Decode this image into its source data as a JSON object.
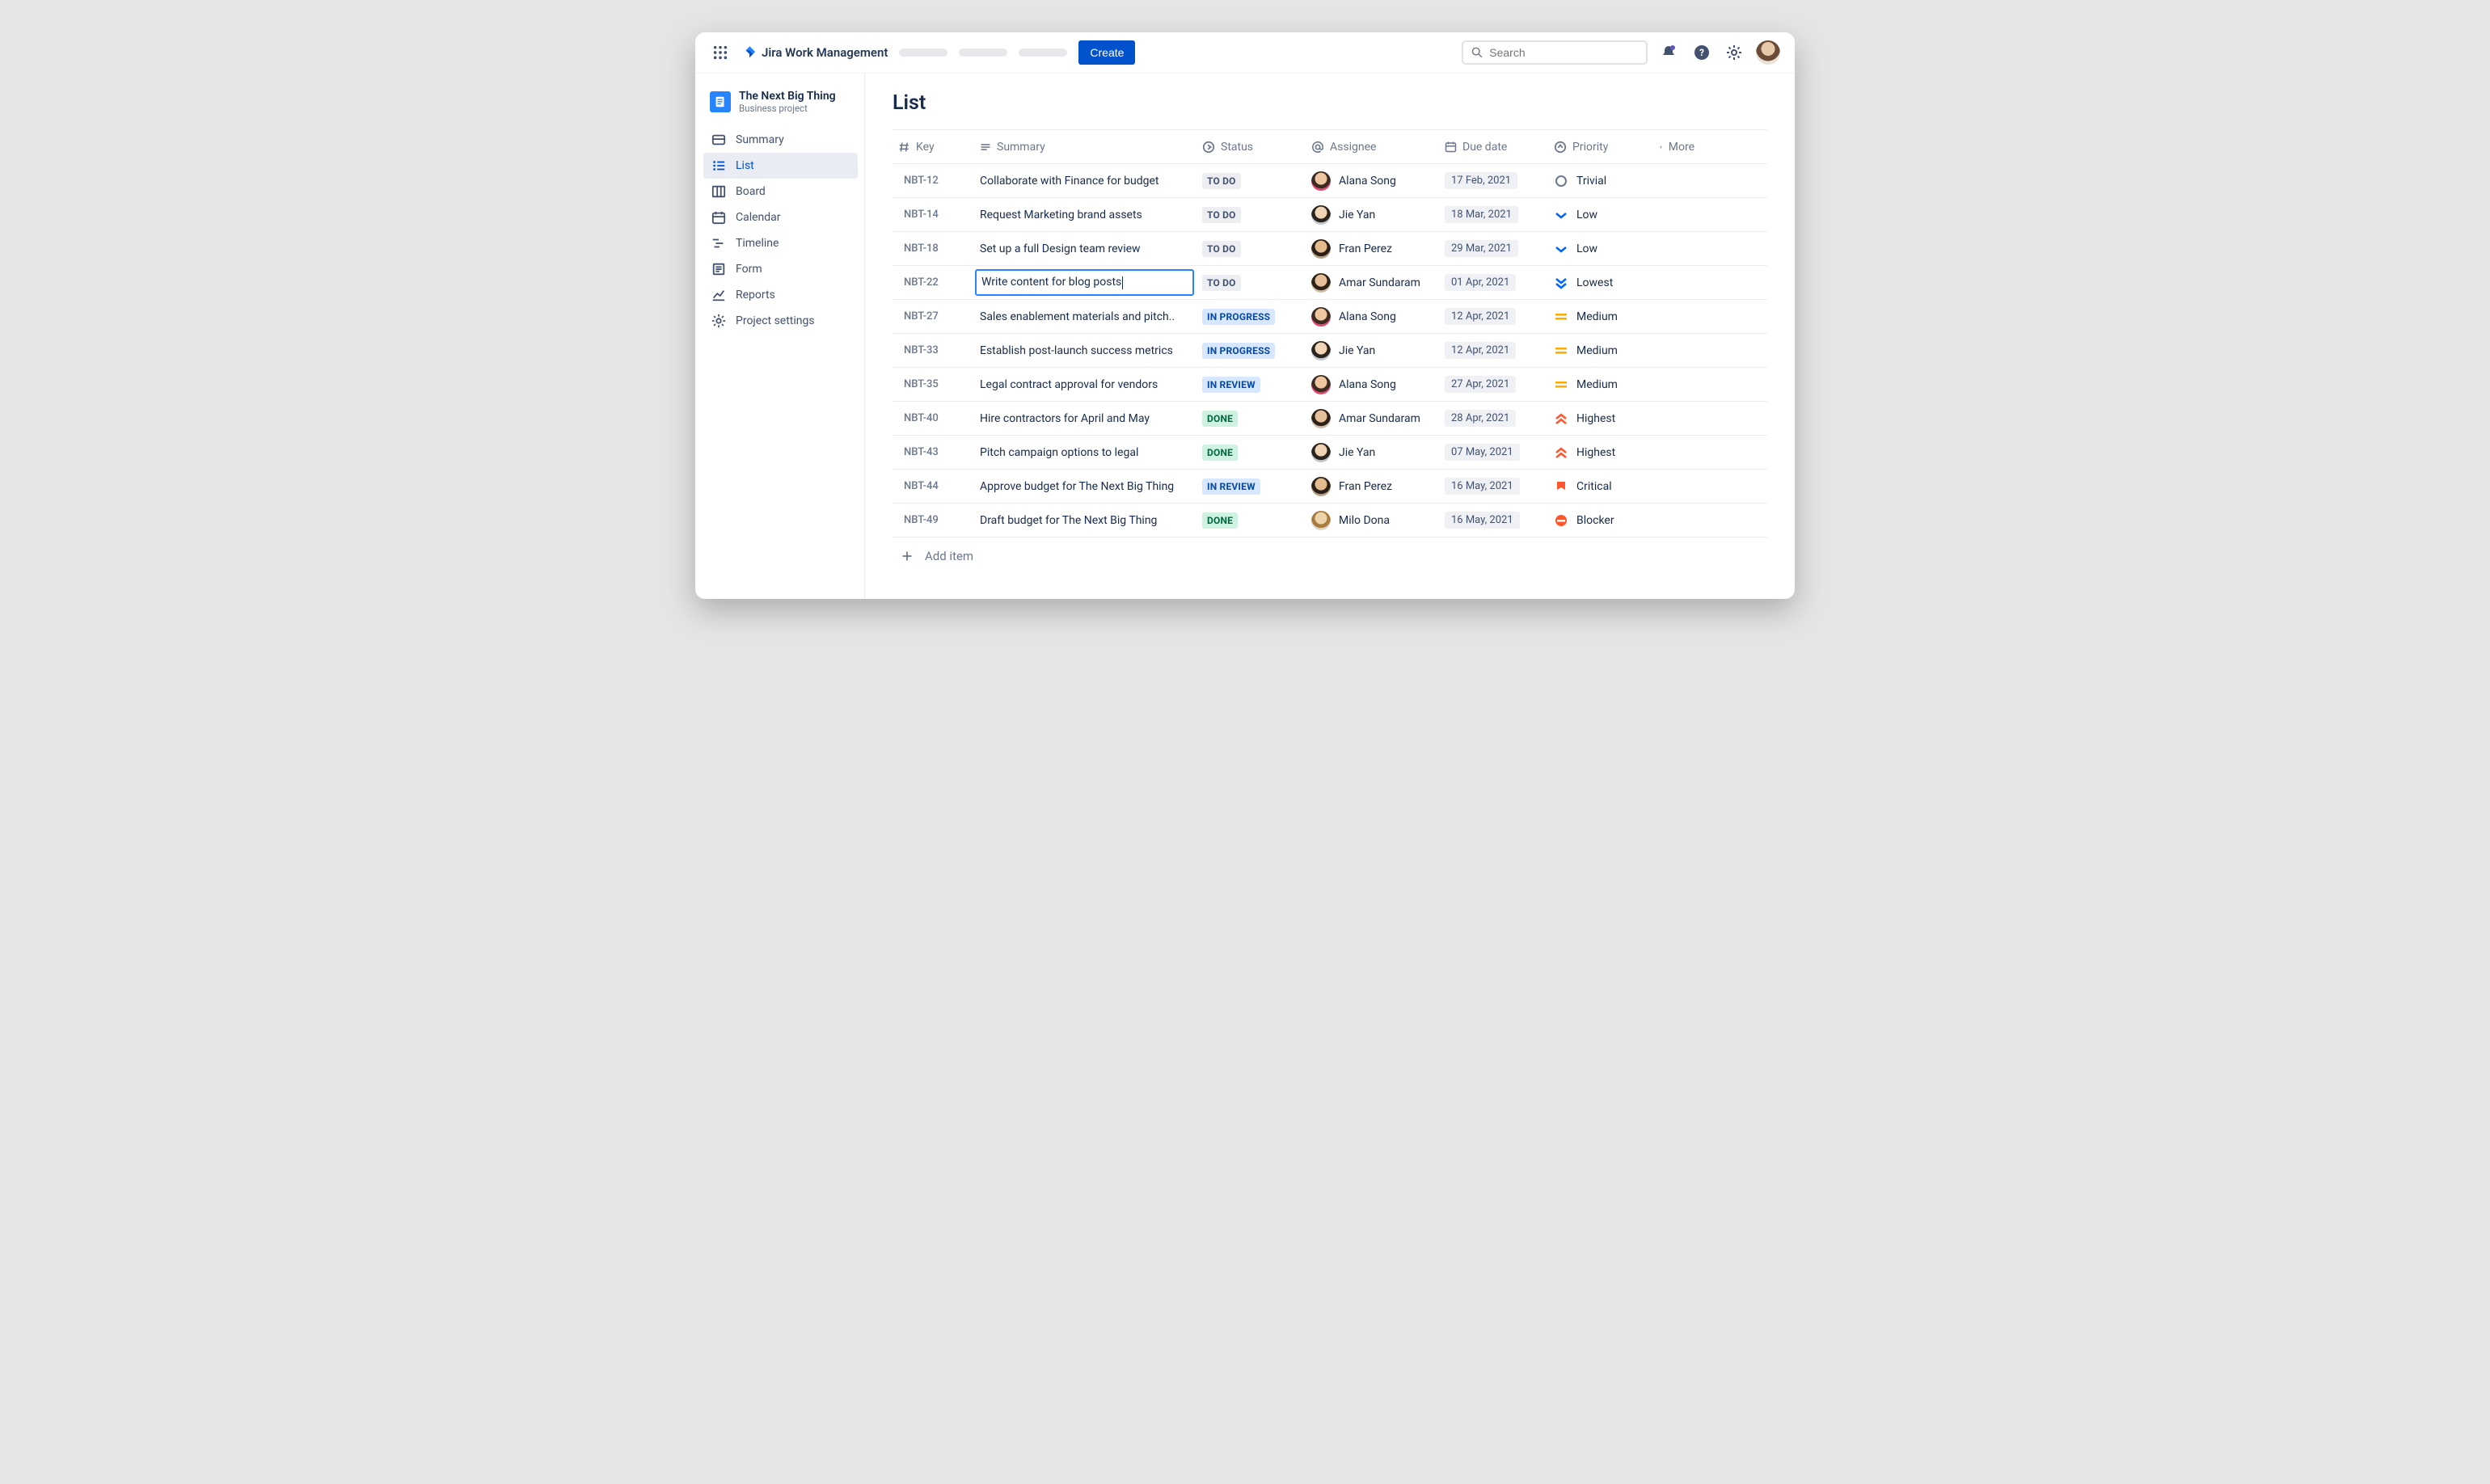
{
  "header": {
    "app_name": "Jira Work Management",
    "create_label": "Create",
    "search_placeholder": "Search"
  },
  "project": {
    "name": "The Next Big Thing",
    "subtitle": "Business project"
  },
  "sidebar": {
    "items": [
      {
        "label": "Summary",
        "icon": "card-icon"
      },
      {
        "label": "List",
        "icon": "list-icon",
        "active": true
      },
      {
        "label": "Board",
        "icon": "board-icon"
      },
      {
        "label": "Calendar",
        "icon": "calendar-icon"
      },
      {
        "label": "Timeline",
        "icon": "timeline-icon"
      },
      {
        "label": "Form",
        "icon": "form-icon"
      },
      {
        "label": "Reports",
        "icon": "chart-icon"
      },
      {
        "label": "Project settings",
        "icon": "gear-icon"
      }
    ]
  },
  "page": {
    "title": "List",
    "add_item_label": "Add item"
  },
  "columns": {
    "key": "Key",
    "summary": "Summary",
    "status": "Status",
    "assignee": "Assignee",
    "due": "Due date",
    "priority": "Priority",
    "more": "More"
  },
  "rows": [
    {
      "key": "NBT-12",
      "summary": "Collaborate with Finance for budget",
      "status": "TO DO",
      "status_kind": "todo",
      "assignee": "Alana Song",
      "av": "a",
      "due": "17 Feb, 2021",
      "priority": "Trivial",
      "pri_kind": "trivial"
    },
    {
      "key": "NBT-14",
      "summary": "Request Marketing brand assets",
      "status": "TO DO",
      "status_kind": "todo",
      "assignee": "Jie Yan",
      "av": "j",
      "due": "18 Mar, 2021",
      "priority": "Low",
      "pri_kind": "low"
    },
    {
      "key": "NBT-18",
      "summary": "Set up a full Design team review",
      "status": "TO DO",
      "status_kind": "todo",
      "assignee": "Fran Perez",
      "av": "f",
      "due": "29 Mar, 2021",
      "priority": "Low",
      "pri_kind": "low"
    },
    {
      "key": "NBT-22",
      "summary": "Write content for blog posts",
      "status": "TO DO",
      "status_kind": "todo",
      "assignee": "Amar Sundaram",
      "av": "s",
      "due": "01 Apr, 2021",
      "priority": "Lowest",
      "pri_kind": "lowest",
      "editing": true
    },
    {
      "key": "NBT-27",
      "summary": "Sales enablement materials and pitch..",
      "status": "IN PROGRESS",
      "status_kind": "progress",
      "assignee": "Alana Song",
      "av": "a",
      "due": "12 Apr, 2021",
      "priority": "Medium",
      "pri_kind": "medium"
    },
    {
      "key": "NBT-33",
      "summary": "Establish post-launch success metrics",
      "status": "IN PROGRESS",
      "status_kind": "progress",
      "assignee": "Jie Yan",
      "av": "j",
      "due": "12 Apr, 2021",
      "priority": "Medium",
      "pri_kind": "medium"
    },
    {
      "key": "NBT-35",
      "summary": "Legal contract approval for vendors",
      "status": "IN REVIEW",
      "status_kind": "review",
      "assignee": "Alana Song",
      "av": "a",
      "due": "27 Apr, 2021",
      "priority": "Medium",
      "pri_kind": "medium"
    },
    {
      "key": "NBT-40",
      "summary": "Hire contractors for April and May",
      "status": "DONE",
      "status_kind": "done",
      "assignee": "Amar Sundaram",
      "av": "s",
      "due": "28 Apr, 2021",
      "priority": "Highest",
      "pri_kind": "highest"
    },
    {
      "key": "NBT-43",
      "summary": "Pitch campaign options to legal",
      "status": "DONE",
      "status_kind": "done",
      "assignee": "Jie Yan",
      "av": "j",
      "due": "07 May, 2021",
      "priority": "Highest",
      "pri_kind": "highest"
    },
    {
      "key": "NBT-44",
      "summary": "Approve budget for The Next Big Thing",
      "status": "IN REVIEW",
      "status_kind": "review",
      "assignee": "Fran Perez",
      "av": "f",
      "due": "16 May, 2021",
      "priority": "Critical",
      "pri_kind": "critical"
    },
    {
      "key": "NBT-49",
      "summary": "Draft budget for The Next Big Thing",
      "status": "DONE",
      "status_kind": "done",
      "assignee": "Milo Dona",
      "av": "m",
      "due": "16 May, 2021",
      "priority": "Blocker",
      "pri_kind": "blocker"
    }
  ]
}
